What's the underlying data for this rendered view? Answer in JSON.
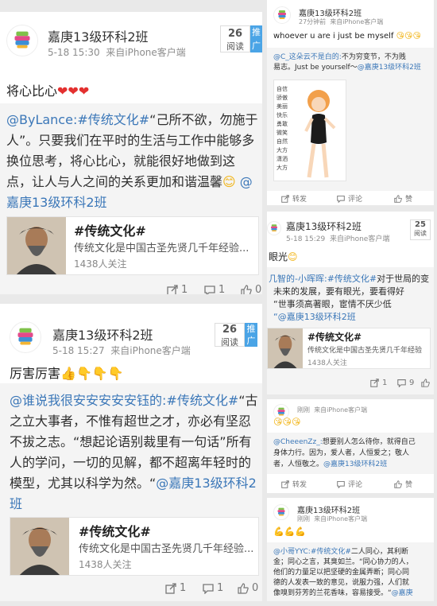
{
  "brand_blue": "#3b77b8",
  "topic_link": "#传统文化#",
  "heart": "❤",
  "thumbs": "👍",
  "point_down": "👇",
  "smile": "😊",
  "kiss": "😘",
  "poster": {
    "name": "嘉庚13级环科2班",
    "source": "来自iPhone客户端"
  },
  "topic_card": {
    "title": "#传统文化#",
    "desc": "传统文化是中国古圣先贤几千年经验...",
    "follow": "1438人关注",
    "desc_short": "传统文化是中国古圣先贤几千年经验",
    "follow_short": "1438人关注"
  },
  "post1": {
    "time": "5-18 15:30",
    "read_count": "26",
    "read_label": "阅读",
    "promote_label": "推广",
    "text": "将心比心",
    "quote_lines": [
      "“己所不欲，勿施于",
      "人”。只要我们在平时的生活与工作中能够多",
      "换位思考，将心比心，就能很好地做到这",
      "点，让人与人之间的关系更加和谐温馨",
      "嘉庚13级环科2班"
    ],
    "quote_author": "@ByLance:",
    "quote_mention": "@",
    "repost_count": "1",
    "comment_count": "1",
    "like_count": "0"
  },
  "post2": {
    "time": "5-18 15:27",
    "read_count": "26",
    "read_label": "阅读",
    "promote_label": "推广",
    "text": "厉害厉害",
    "quote_author": "@谁说我很安安安安安钰的:",
    "quote_tail": "“古",
    "quote_lines": [
      "之立大事者，不惟有超世之才，亦必有坚忍",
      "不拔之志。“想起论语别裁里有一句话”所有",
      "人的学问，一切的见解，都不超离年轻时的",
      "模型，尤其以科学为然。“",
      "班"
    ],
    "quote_mention": "@嘉庚13级环科2",
    "repost_count": "1",
    "comment_count": "1",
    "like_count": "0"
  },
  "post3": {
    "time": "27分钟前",
    "source": "来自iPhone客户端",
    "text": "whoever u are i just be myself",
    "quote_line1_author": "@C_这朵云不是白的:",
    "quote_line1_text": "不为穷变节，不为贱",
    "quote_line2_text": "易志。",
    "quote_line2_mid": "Just be yourself～",
    "quote_mention": "@嘉庚13级环科2班",
    "image_words": [
      "自信",
      "骄傲",
      "美丽",
      "快乐",
      "勇敢",
      "微笑",
      "自然",
      "大方",
      "潇洒",
      "大方"
    ],
    "repost_label": "转发",
    "comment_label": "评论",
    "like_label": "赞"
  },
  "post4": {
    "time": "5-18 15:29",
    "read_count": "25",
    "read_label": "阅读",
    "text": "眼光",
    "quote_author": "几智的-小晖晖:",
    "quote_l1_tail": "对于世局的变",
    "quote_l2": "未来的发展，要有眼光，要看得好",
    "quote_l3": "“世事须高著眼，宦情不厌少低",
    "quote_l4_mention": "“@嘉庚13级环科2班",
    "repost_count": "1",
    "comment_count": "9"
  },
  "post5": {
    "time": "刚刚",
    "source": "来自iPhone客户端",
    "quote_author": "@CheeenZz_:",
    "quote_lines": [
      "想要别人怎么待你，就得自己",
      "身体力行。因为，爱人者，人恒爱之；敬人",
      "者，人恒敬之。"
    ],
    "quote_mention": "@嘉庚13级环科2班",
    "repost_label": "转发",
    "comment_label": "评论",
    "like_label": "赞"
  },
  "post6": {
    "time": "刚刚",
    "source": "来自iPhone客户端",
    "muscle": "💪💪💪",
    "quote_author": "@小哥YYC:",
    "quote_head_tail": "二人同心，其利断",
    "quote_lines": [
      "金；同心之言，其臭如兰。“同心协力的人，",
      "他们的力量足以把坚硬的金属弄断；同心同",
      "德的人发表一致的意见，说服力强，人们就",
      "像嗅到芬芳的兰花香味，容易接受。“"
    ],
    "quote_mention": "@嘉庚"
  }
}
